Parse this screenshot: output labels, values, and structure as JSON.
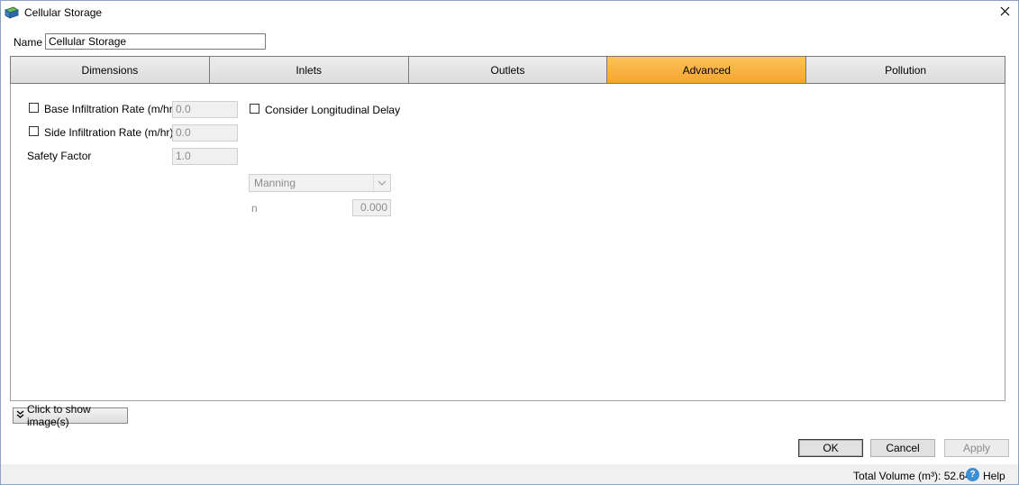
{
  "window": {
    "title": "Cellular Storage"
  },
  "name_field": {
    "label": "Name",
    "value": "Cellular Storage"
  },
  "tabs": [
    {
      "label": "Dimensions",
      "active": false
    },
    {
      "label": "Inlets",
      "active": false
    },
    {
      "label": "Outlets",
      "active": false
    },
    {
      "label": "Advanced",
      "active": true
    },
    {
      "label": "Pollution",
      "active": false
    }
  ],
  "advanced": {
    "base_infiltration": {
      "label": "Base Infiltration Rate (m/hr)",
      "checked": false,
      "value": "0.0"
    },
    "side_infiltration": {
      "label": "Side Infiltration Rate (m/hr)",
      "checked": false,
      "value": "0.0"
    },
    "safety_factor": {
      "label": "Safety Factor",
      "value": "1.0"
    },
    "longitudinal_delay": {
      "label": "Consider Longitudinal Delay",
      "checked": false
    },
    "roughness_method": {
      "selected": "Manning"
    },
    "n_field": {
      "label": "n",
      "value": "0.000"
    }
  },
  "images_toggle": {
    "label": "Click to show image(s)"
  },
  "buttons": {
    "ok": "OK",
    "cancel": "Cancel",
    "apply": "Apply"
  },
  "status": {
    "total_volume": "Total Volume (m³): 52.640",
    "help": "Help"
  },
  "colors": {
    "active_tab": "#f7a52d",
    "help_icon": "#3a8fd6"
  }
}
